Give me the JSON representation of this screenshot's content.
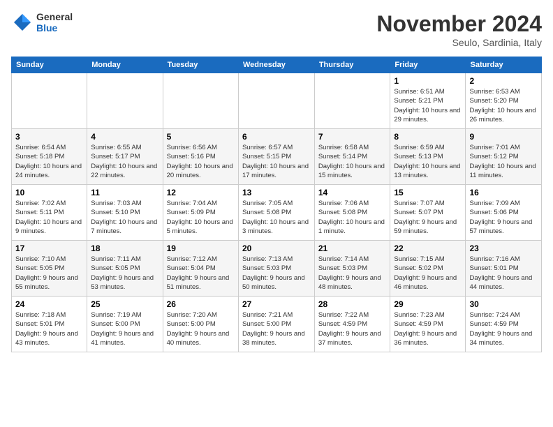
{
  "header": {
    "logo_general": "General",
    "logo_blue": "Blue",
    "month_title": "November 2024",
    "location": "Seulo, Sardinia, Italy"
  },
  "weekdays": [
    "Sunday",
    "Monday",
    "Tuesday",
    "Wednesday",
    "Thursday",
    "Friday",
    "Saturday"
  ],
  "weeks": [
    [
      {
        "day": "",
        "info": ""
      },
      {
        "day": "",
        "info": ""
      },
      {
        "day": "",
        "info": ""
      },
      {
        "day": "",
        "info": ""
      },
      {
        "day": "",
        "info": ""
      },
      {
        "day": "1",
        "info": "Sunrise: 6:51 AM\nSunset: 5:21 PM\nDaylight: 10 hours and 29 minutes."
      },
      {
        "day": "2",
        "info": "Sunrise: 6:53 AM\nSunset: 5:20 PM\nDaylight: 10 hours and 26 minutes."
      }
    ],
    [
      {
        "day": "3",
        "info": "Sunrise: 6:54 AM\nSunset: 5:18 PM\nDaylight: 10 hours and 24 minutes."
      },
      {
        "day": "4",
        "info": "Sunrise: 6:55 AM\nSunset: 5:17 PM\nDaylight: 10 hours and 22 minutes."
      },
      {
        "day": "5",
        "info": "Sunrise: 6:56 AM\nSunset: 5:16 PM\nDaylight: 10 hours and 20 minutes."
      },
      {
        "day": "6",
        "info": "Sunrise: 6:57 AM\nSunset: 5:15 PM\nDaylight: 10 hours and 17 minutes."
      },
      {
        "day": "7",
        "info": "Sunrise: 6:58 AM\nSunset: 5:14 PM\nDaylight: 10 hours and 15 minutes."
      },
      {
        "day": "8",
        "info": "Sunrise: 6:59 AM\nSunset: 5:13 PM\nDaylight: 10 hours and 13 minutes."
      },
      {
        "day": "9",
        "info": "Sunrise: 7:01 AM\nSunset: 5:12 PM\nDaylight: 10 hours and 11 minutes."
      }
    ],
    [
      {
        "day": "10",
        "info": "Sunrise: 7:02 AM\nSunset: 5:11 PM\nDaylight: 10 hours and 9 minutes."
      },
      {
        "day": "11",
        "info": "Sunrise: 7:03 AM\nSunset: 5:10 PM\nDaylight: 10 hours and 7 minutes."
      },
      {
        "day": "12",
        "info": "Sunrise: 7:04 AM\nSunset: 5:09 PM\nDaylight: 10 hours and 5 minutes."
      },
      {
        "day": "13",
        "info": "Sunrise: 7:05 AM\nSunset: 5:08 PM\nDaylight: 10 hours and 3 minutes."
      },
      {
        "day": "14",
        "info": "Sunrise: 7:06 AM\nSunset: 5:08 PM\nDaylight: 10 hours and 1 minute."
      },
      {
        "day": "15",
        "info": "Sunrise: 7:07 AM\nSunset: 5:07 PM\nDaylight: 9 hours and 59 minutes."
      },
      {
        "day": "16",
        "info": "Sunrise: 7:09 AM\nSunset: 5:06 PM\nDaylight: 9 hours and 57 minutes."
      }
    ],
    [
      {
        "day": "17",
        "info": "Sunrise: 7:10 AM\nSunset: 5:05 PM\nDaylight: 9 hours and 55 minutes."
      },
      {
        "day": "18",
        "info": "Sunrise: 7:11 AM\nSunset: 5:05 PM\nDaylight: 9 hours and 53 minutes."
      },
      {
        "day": "19",
        "info": "Sunrise: 7:12 AM\nSunset: 5:04 PM\nDaylight: 9 hours and 51 minutes."
      },
      {
        "day": "20",
        "info": "Sunrise: 7:13 AM\nSunset: 5:03 PM\nDaylight: 9 hours and 50 minutes."
      },
      {
        "day": "21",
        "info": "Sunrise: 7:14 AM\nSunset: 5:03 PM\nDaylight: 9 hours and 48 minutes."
      },
      {
        "day": "22",
        "info": "Sunrise: 7:15 AM\nSunset: 5:02 PM\nDaylight: 9 hours and 46 minutes."
      },
      {
        "day": "23",
        "info": "Sunrise: 7:16 AM\nSunset: 5:01 PM\nDaylight: 9 hours and 44 minutes."
      }
    ],
    [
      {
        "day": "24",
        "info": "Sunrise: 7:18 AM\nSunset: 5:01 PM\nDaylight: 9 hours and 43 minutes."
      },
      {
        "day": "25",
        "info": "Sunrise: 7:19 AM\nSunset: 5:00 PM\nDaylight: 9 hours and 41 minutes."
      },
      {
        "day": "26",
        "info": "Sunrise: 7:20 AM\nSunset: 5:00 PM\nDaylight: 9 hours and 40 minutes."
      },
      {
        "day": "27",
        "info": "Sunrise: 7:21 AM\nSunset: 5:00 PM\nDaylight: 9 hours and 38 minutes."
      },
      {
        "day": "28",
        "info": "Sunrise: 7:22 AM\nSunset: 4:59 PM\nDaylight: 9 hours and 37 minutes."
      },
      {
        "day": "29",
        "info": "Sunrise: 7:23 AM\nSunset: 4:59 PM\nDaylight: 9 hours and 36 minutes."
      },
      {
        "day": "30",
        "info": "Sunrise: 7:24 AM\nSunset: 4:59 PM\nDaylight: 9 hours and 34 minutes."
      }
    ]
  ]
}
